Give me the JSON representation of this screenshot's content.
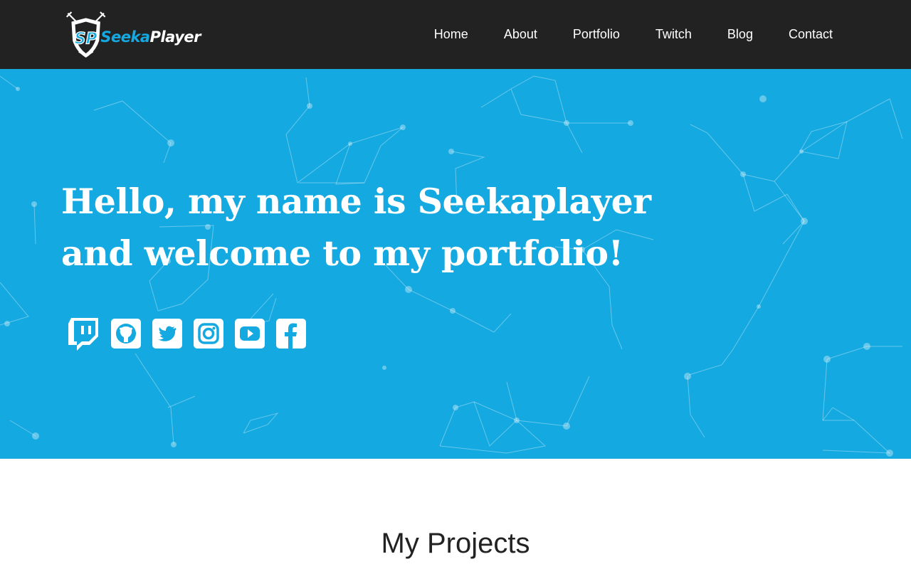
{
  "brand": {
    "logo_initials": "SP",
    "name_part1": "Seeka",
    "name_part2": "Player",
    "accent_color": "#16a9e1"
  },
  "nav": {
    "items": [
      {
        "label": "Home"
      },
      {
        "label": "About"
      },
      {
        "label": "Portfolio"
      },
      {
        "label": "Twitch"
      },
      {
        "label": "Blog"
      },
      {
        "label": "Contact"
      }
    ]
  },
  "hero": {
    "line1": "Hello, my name is Seekaplayer",
    "line2": "and welcome to my portfolio!",
    "background_color": "#14a9e0",
    "social_icons": [
      "twitch-icon",
      "github-icon",
      "twitter-icon",
      "instagram-icon",
      "youtube-icon",
      "facebook-icon"
    ]
  },
  "projects": {
    "title": "My Projects"
  }
}
